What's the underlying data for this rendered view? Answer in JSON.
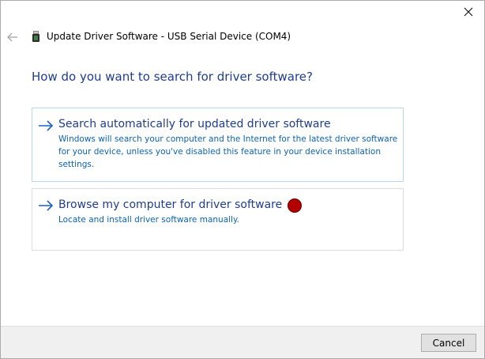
{
  "window": {
    "title": "Update Driver Software - USB Serial Device (COM4)",
    "close_icon": "close-icon",
    "back_icon": "back-arrow-icon",
    "device_icon": "usb-device-icon"
  },
  "main": {
    "heading": "How do you want to search for driver software?",
    "options": [
      {
        "icon": "right-arrow-icon",
        "title": "Search automatically for updated driver software",
        "description": "Windows will search your computer and the Internet for the latest driver software for your device, unless you've disabled this feature in your device installation settings."
      },
      {
        "icon": "right-arrow-icon",
        "title": "Browse my computer for driver software",
        "description": "Locate and install driver software manually."
      }
    ]
  },
  "footer": {
    "cancel_label": "Cancel"
  },
  "colors": {
    "heading": "#1e3d8f",
    "description": "#0a63b8",
    "option_border_highlight": "#b9d9ea",
    "cursor_marker": "#b30000"
  }
}
